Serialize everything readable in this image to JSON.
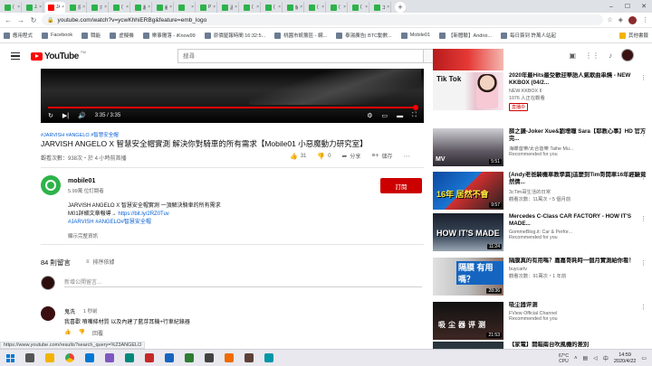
{
  "browser": {
    "tabs": [
      {
        "label": "(",
        "type": "green"
      },
      {
        "label": "JAI",
        "type": "green"
      },
      {
        "label": "JAI",
        "type": "yt",
        "active": true
      },
      {
        "label": "探S",
        "type": "green"
      },
      {
        "label": "只奇",
        "type": "green"
      },
      {
        "label": "(",
        "type": "green"
      },
      {
        "label": "超G",
        "type": "green"
      },
      {
        "label": "顧V",
        "type": "green"
      },
      {
        "label": "「主",
        "type": "green"
      },
      {
        "label": "PAI",
        "type": "green"
      },
      {
        "label": "溫S",
        "type": "green"
      },
      {
        "label": "(",
        "type": "green"
      },
      {
        "label": "(",
        "type": "green"
      },
      {
        "label": "解",
        "type": "green"
      },
      {
        "label": "(",
        "type": "green"
      },
      {
        "label": "(",
        "type": "green"
      },
      {
        "label": "(",
        "type": "green"
      },
      {
        "label": "工R",
        "type": "green"
      }
    ],
    "url": "youtube.com/watch?v=ycwKhhiERBg&feature=emb_logo",
    "bookmarks": [
      "應用程式",
      "Facebook",
      "職能",
      "虛擬機",
      "樂事攤落 - iKnow99",
      "原價屋報時間 16:32:5...",
      "桃園市統籌區 - 網...",
      "泰湯廣告| BTC動數...",
      "Mobile01",
      "【新體驗】Androi...",
      "每日簽到 許萬人站起"
    ],
    "other_bookmarks": "其他書籤"
  },
  "youtube": {
    "logo_text": "YouTube",
    "logo_tw": "TW",
    "search_placeholder": "搜尋"
  },
  "video": {
    "time": "3:35 / 3:35",
    "progress_fraction": 1.0,
    "hashtags": "#JARVISH #ANGELO #智慧安全帽",
    "title": "JARVISH ANGELO X 智慧安全帽實測 解決你對騎車的所有需求【Mobile01 小惡魔動力研究室】",
    "meta": "觀看次數：938次・於 4 小時前首播",
    "likes": "31",
    "dislikes": "0",
    "share": "分享",
    "save": "儲存"
  },
  "channel": {
    "name": "mobile01",
    "subs": "5.99萬 位訂閱者",
    "subscribe_label": "訂閱"
  },
  "description": {
    "line1": "JARVISH ANGELO X 智慧安全帽實測 一頂解決騎車的所有需求",
    "line2_text": "M01詳細文章報導→ ",
    "line2_link": "https://bit.ly/2RZ0Tuv",
    "line3": "#JARVISH #ANGELO#智慧安全帽",
    "show_more": "顯示完整資訊"
  },
  "comments": {
    "count": "84 則留言",
    "sort_label": "排序依據",
    "add_placeholder": "新增公開留言...",
    "items": [
      {
        "author": "鬼洗",
        "time": "1 秒前",
        "text": "我喜歡 噴嘴條材質 以及內建了藍芽耳機+行車紀錄器",
        "reply": "回覆"
      }
    ]
  },
  "recommended": [
    {
      "title": "2020年最Hits最受歡迎華語人氣歌曲串燒 - NEW KKBOX (04/2...",
      "channel": "NEW KKBOX II",
      "meta": "1076 人正在觀看",
      "badge": "直播中",
      "duration": "",
      "thumb_text": "Tik Tok"
    },
    {
      "title": "薛之謙-Joker Xue&劉增瞳 Sara【耶教心事】HD 官方完...",
      "channel": "海蝶音樂/太合音樂 Taihe Mu...",
      "meta": "Recommended for you",
      "badge": "",
      "duration": "5:51",
      "thumb_text": "MV"
    },
    {
      "title": "[Andy老爸騎機車教學篇]這麼到Tim哥開車16年經驗竟然倩...",
      "channel": "3cTim哥生活的日常",
      "meta": "觀看次數：11萬次・5 個月前",
      "badge": "",
      "duration": "9:57",
      "thumb_text": "16年 居然不會"
    },
    {
      "title": "Mercedes C-Class CAR FACTORY - HOW IT'S MADE...",
      "channel": "GommeBlog.it: Car & Perfor...",
      "meta": "Recommended for you",
      "badge": "",
      "duration": "11:24",
      "thumb_text": "HOW IT'S MADE"
    },
    {
      "title": "隔膜真的有用嗎？嘉嘉哥耗時一個月實測給你看！",
      "channel": "buycartv",
      "meta": "觀看次數：91萬次・1 年前",
      "badge": "",
      "duration": "28:36",
      "thumb_text": "隔膜 有用嗎？"
    },
    {
      "title": "吸尘器评测",
      "channel": "FView Official Channel",
      "meta": "Recommended for you",
      "badge": "",
      "duration": "21:53",
      "thumb_text": "吸尘器评测"
    },
    {
      "title": "【家電】開箱兩台吹風機的差別",
      "channel": "",
      "meta": "",
      "badge": "",
      "duration": "",
      "thumb_text": ""
    }
  ],
  "status_url": "https://www.youtube.com/results?search_query=%23ANGELO",
  "taskbar": {
    "weather": "67°C",
    "weather_sub": "CPU",
    "ime": "中",
    "time": "14:59",
    "date": "2020/4/22"
  }
}
